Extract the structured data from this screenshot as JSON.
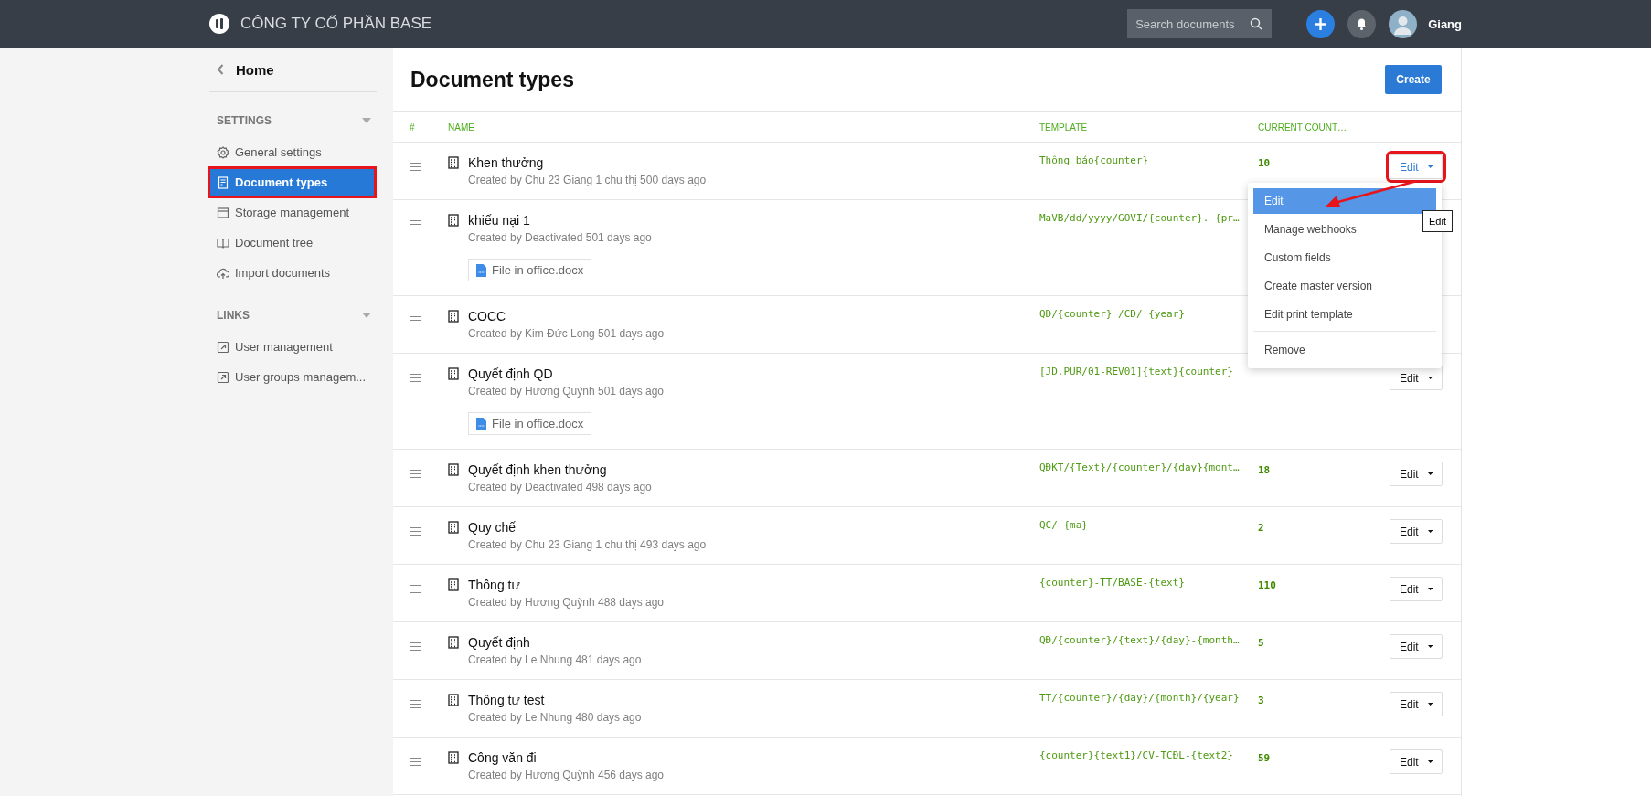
{
  "topbar": {
    "company": "CÔNG TY CỐ PHẦN BASE",
    "search": {
      "placeholder": "Search documents"
    },
    "user": "Giang"
  },
  "sidebar": {
    "home": "Home",
    "sections": [
      {
        "title": "SETTINGS",
        "expanded": true,
        "items": [
          {
            "label": "General settings",
            "kind": "gear",
            "selected": false,
            "annotated": false
          },
          {
            "label": "Document types",
            "kind": "doc",
            "selected": true,
            "annotated": true
          },
          {
            "label": "Storage management",
            "kind": "box",
            "selected": false,
            "annotated": false
          },
          {
            "label": "Document tree",
            "kind": "book",
            "selected": false,
            "annotated": false
          },
          {
            "label": "Import documents",
            "kind": "cloud",
            "selected": false,
            "annotated": false
          }
        ]
      },
      {
        "title": "LINKS",
        "expanded": true,
        "items": [
          {
            "label": "User management",
            "kind": "link",
            "selected": false,
            "annotated": false
          },
          {
            "label": "User groups managem...",
            "kind": "link",
            "selected": false,
            "annotated": false
          }
        ]
      }
    ]
  },
  "page": {
    "title": "Document types",
    "create_button": "Create"
  },
  "table": {
    "columns": [
      "#",
      "NAME",
      "TEMPLATE",
      "CURRENT COUNT…"
    ],
    "rows": [
      {
        "name": "Khen thưởng",
        "created": "Created by Chu 23 Giang 1 chu thị 500 days ago",
        "template": "Thông báo{counter}",
        "counter": "10",
        "edit_button": {
          "label": "Edit",
          "open": true,
          "annotated": true
        }
      },
      {
        "name": "khiếu nại 1",
        "created": "Created by Deactivated 501 days ago",
        "template": "MaVB/dd/yyyy/GOVI/{counter}. {pr…",
        "attachment": "File in office.docx"
      },
      {
        "name": "COCC",
        "created": "Created by Kim Đức Long 501 days ago",
        "template": "QD/{counter} /CD/ {year}"
      },
      {
        "name": "Quyết định QD",
        "created": "Created by Hương Quỳnh 501 days ago",
        "template": "[JD.PUR/01-REV01]{text}{counter}",
        "attachment": "File in office.docx",
        "edit_button": {
          "label": "Edit",
          "open": false,
          "annotated": false
        }
      },
      {
        "name": "Quyết định khen thưởng",
        "created": "Created by Deactivated 498 days ago",
        "template": "QĐKT/{Text}/{counter}/{day}{mont…",
        "counter": "18",
        "edit_button": {
          "label": "Edit",
          "open": false,
          "annotated": false
        }
      },
      {
        "name": "Quy chế",
        "created": "Created by Chu 23 Giang 1 chu thị 493 days ago",
        "template": "QC/ {ma}",
        "counter": "2",
        "edit_button": {
          "label": "Edit",
          "open": false,
          "annotated": false
        }
      },
      {
        "name": "Thông tư",
        "created": "Created by Hương Quỳnh 488 days ago",
        "template": "{counter}-TT/BASE-{text}",
        "counter": "110",
        "edit_button": {
          "label": "Edit",
          "open": false,
          "annotated": false
        }
      },
      {
        "name": "Quyết định",
        "created": "Created by Le Nhung 481 days ago",
        "template": "QĐ/{counter}/{text}/{day}-{month…",
        "counter": "5",
        "edit_button": {
          "label": "Edit",
          "open": false,
          "annotated": false
        }
      },
      {
        "name": "Thông tư test",
        "created": "Created by Le Nhung 480 days ago",
        "template": "TT/{counter}/{day}/{month}/{year}",
        "counter": "3",
        "edit_button": {
          "label": "Edit",
          "open": false,
          "annotated": false
        }
      },
      {
        "name": "Công văn đi",
        "created": "Created by Hương Quỳnh 456 days ago",
        "template": "{counter}{text1}/CV-TCĐL-{text2}",
        "counter": "59",
        "edit_button": {
          "label": "Edit",
          "open": false,
          "annotated": false
        }
      }
    ]
  },
  "menu": {
    "items": [
      {
        "label": "Edit",
        "selected": true,
        "divider_before": false
      },
      {
        "label": "Manage webhooks",
        "selected": false,
        "divider_before": false
      },
      {
        "label": "Custom fields",
        "selected": false,
        "divider_before": false
      },
      {
        "label": "Create master version",
        "selected": false,
        "divider_before": false
      },
      {
        "label": "Edit print template",
        "selected": false,
        "divider_before": false
      },
      {
        "label": "Remove",
        "selected": false,
        "divider_before": true
      }
    ],
    "tooltip": "Edit"
  }
}
